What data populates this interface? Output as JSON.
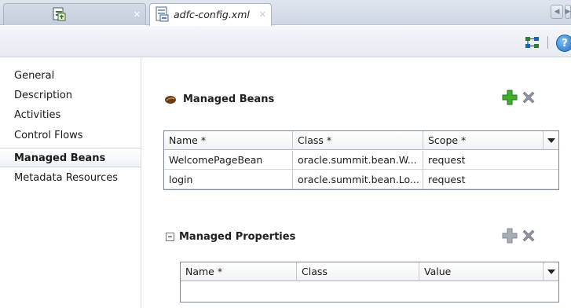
{
  "tabs": [
    {
      "label": "",
      "icon": "generic-file-icon",
      "active": false
    },
    {
      "label": "adfc-config.xml",
      "icon": "xml-file-icon",
      "active": true
    }
  ],
  "toolbar": {
    "icons": [
      "diagram-toggle-icon",
      "help-icon"
    ],
    "help_glyph": "?"
  },
  "nav": {
    "items": [
      {
        "label": "General"
      },
      {
        "label": "Description"
      },
      {
        "label": "Activities"
      },
      {
        "label": "Control Flows"
      },
      {
        "label": "Managed Beans",
        "selected": true
      },
      {
        "label": "Metadata Resources"
      }
    ]
  },
  "managed_beans": {
    "title": "Managed Beans",
    "columns": [
      "Name *",
      "Class *",
      "Scope *"
    ],
    "rows": [
      {
        "name": "WelcomePageBean",
        "class": "oracle.summit.bean.W...",
        "scope": "request"
      },
      {
        "name": "login",
        "class": "oracle.summit.bean.Lo...",
        "scope": "request"
      }
    ]
  },
  "managed_properties": {
    "title": "Managed Properties",
    "columns": [
      "Name *",
      "Class",
      "Value"
    ]
  },
  "colors": {
    "add_green": "#3fae2a",
    "delete_gray": "#8e959e",
    "help_blue": "#1d6fc4"
  }
}
